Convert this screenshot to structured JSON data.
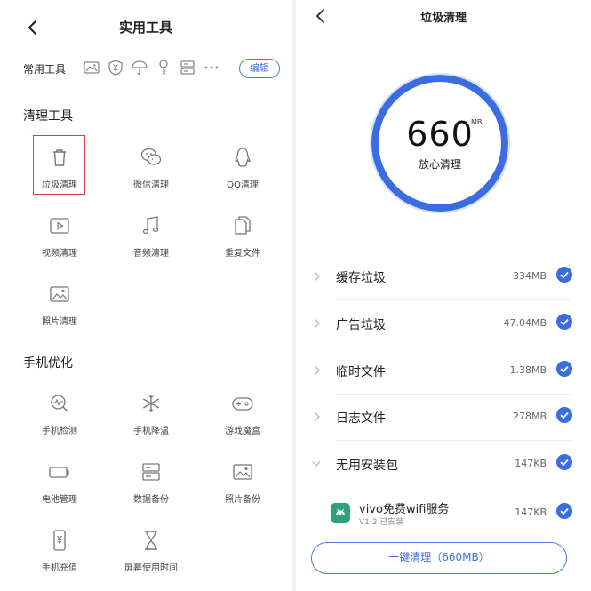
{
  "left": {
    "title": "实用工具",
    "frequent": {
      "label": "常用工具",
      "icons": [
        "image-icon",
        "yuan-shield-icon",
        "umbrella-icon",
        "key-icon",
        "storage-icon",
        "more-icon"
      ],
      "edit_label": "编辑"
    },
    "clean_section": {
      "title": "清理工具",
      "items": [
        {
          "label": "垃圾清理",
          "icon": "trash-icon"
        },
        {
          "label": "微信清理",
          "icon": "wechat-icon"
        },
        {
          "label": "QQ清理",
          "icon": "qq-icon"
        },
        {
          "label": "视频清理",
          "icon": "video-icon"
        },
        {
          "label": "音频清理",
          "icon": "music-icon"
        },
        {
          "label": "重复文件",
          "icon": "duplicate-file-icon"
        },
        {
          "label": "照片清理",
          "icon": "photo-icon"
        }
      ]
    },
    "optimize_section": {
      "title": "手机优化",
      "items": [
        {
          "label": "手机检测",
          "icon": "phone-check-icon"
        },
        {
          "label": "手机降温",
          "icon": "snowflake-icon"
        },
        {
          "label": "游戏魔盒",
          "icon": "gamepad-icon"
        },
        {
          "label": "电池管理",
          "icon": "battery-icon"
        },
        {
          "label": "数据备份",
          "icon": "data-backup-icon"
        },
        {
          "label": "照片备份",
          "icon": "photo-backup-icon"
        },
        {
          "label": "手机充值",
          "icon": "phone-recharge-icon"
        },
        {
          "label": "屏幕使用时间",
          "icon": "hourglass-icon"
        }
      ]
    }
  },
  "right": {
    "title": "垃圾清理",
    "gauge": {
      "value": "660",
      "unit": "MB",
      "status": "放心清理"
    },
    "accent_color": "#3b6de0",
    "categories": [
      {
        "name": "缓存垃圾",
        "size": "334MB",
        "checked": true,
        "expanded": false
      },
      {
        "name": "广告垃圾",
        "size": "47.04MB",
        "checked": true,
        "expanded": false
      },
      {
        "name": "临时文件",
        "size": "1.38MB",
        "checked": true,
        "expanded": false
      },
      {
        "name": "日志文件",
        "size": "278MB",
        "checked": true,
        "expanded": false
      },
      {
        "name": "无用安装包",
        "size": "147KB",
        "checked": true,
        "expanded": true
      }
    ],
    "app": {
      "name": "vivo免费wifi服务",
      "version": "V1.2 已安装",
      "size": "147KB",
      "checked": true
    },
    "clean_button": "一键清理（660MB）"
  }
}
